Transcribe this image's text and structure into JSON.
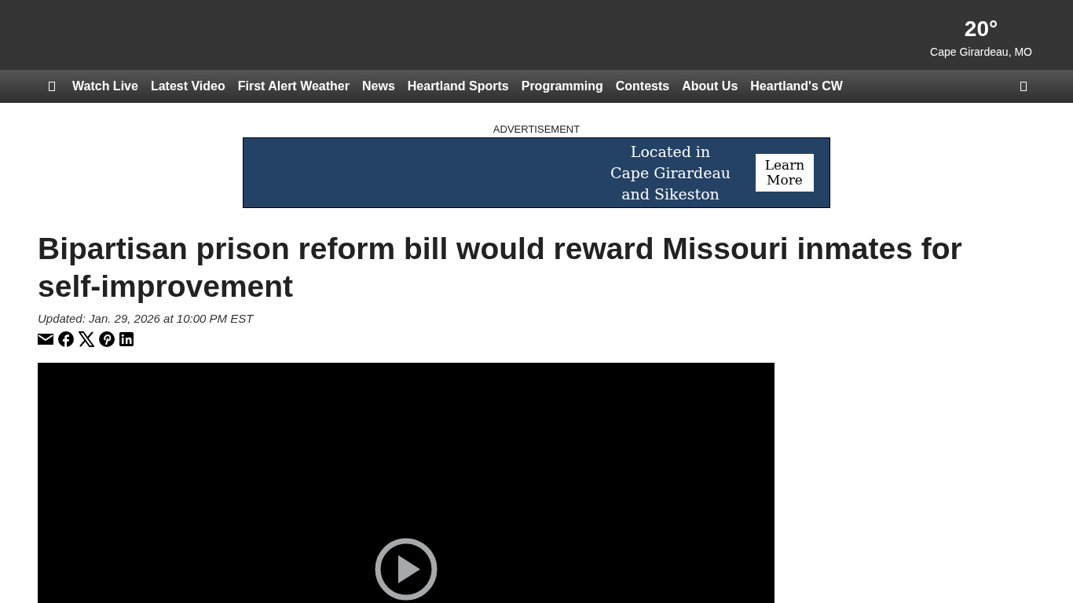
{
  "weather": {
    "temperature": "20°",
    "location": "Cape Girardeau, MO"
  },
  "nav": {
    "items": [
      {
        "label": "Watch Live"
      },
      {
        "label": "Latest Video"
      },
      {
        "label": "First Alert Weather"
      },
      {
        "label": "News"
      },
      {
        "label": "Heartland Sports"
      },
      {
        "label": "Programming"
      },
      {
        "label": "Contests"
      },
      {
        "label": "About Us"
      },
      {
        "label": "Heartland's CW"
      }
    ]
  },
  "ad": {
    "label": "ADVERTISEMENT",
    "lines": [
      "Located in",
      "Cape Girardeau",
      "and Sikeston"
    ],
    "button": "Learn More"
  },
  "article": {
    "headline": "Bipartisan prison reform bill would reward Missouri inmates for self-improvement",
    "updated": "Updated: Jan. 29, 2026 at 10:00 PM EST",
    "share": [
      {
        "kind": "email"
      },
      {
        "kind": "facebook"
      },
      {
        "kind": "x"
      },
      {
        "kind": "pinterest"
      },
      {
        "kind": "linkedin"
      }
    ]
  },
  "video": {
    "kind": "player"
  }
}
